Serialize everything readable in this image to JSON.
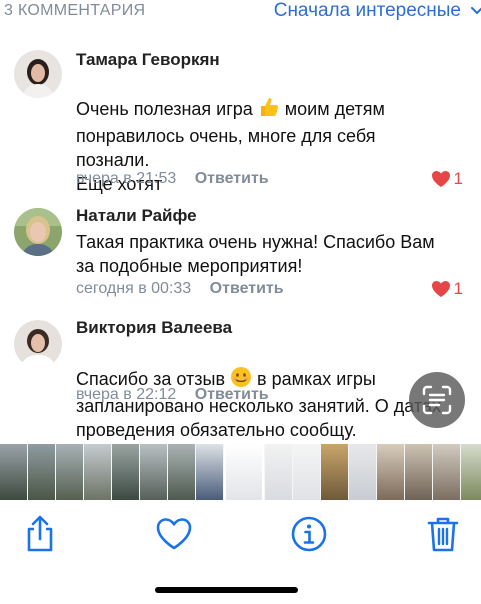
{
  "header": {
    "count_label": "3 КОММЕНТАРИЯ",
    "sort_label": "Сначала интересные"
  },
  "comments": [
    {
      "author": "Тамара Геворкян",
      "text_before_emoji": "Очень полезная игра ",
      "emoji": "thumbs-up",
      "text_after_emoji": "  моим детям\nпонравилось очень, многе для себя\nпознали.\n Еще хотят",
      "date": "вчера в 21:53",
      "reply_label": "Ответить",
      "likes": "1"
    },
    {
      "author": "Натали Райфе",
      "text": "Такая практика очень нужна! Спасибо Вам\nза подобные мероприятия!",
      "date": "сегодня в 00:33",
      "reply_label": "Ответить",
      "likes": "1"
    },
    {
      "author": "Виктория Валеева",
      "text_before_emoji": "Спасибо за отзыв ",
      "emoji": "smiling-face",
      "text_after_emoji": " в рамках игры\nзапланировано несколько занятий. О датах\nпроведения обязательно сообщу.",
      "date": "вчера в 22:12",
      "reply_label": "Ответить"
    }
  ],
  "toolbar": {
    "icons": [
      "share-icon",
      "heart-icon",
      "info-icon",
      "trash-icon"
    ],
    "accent": "#1a73e8"
  },
  "colors": {
    "link": "#2a6fd6",
    "meta": "#818c99",
    "like": "#e64646"
  }
}
